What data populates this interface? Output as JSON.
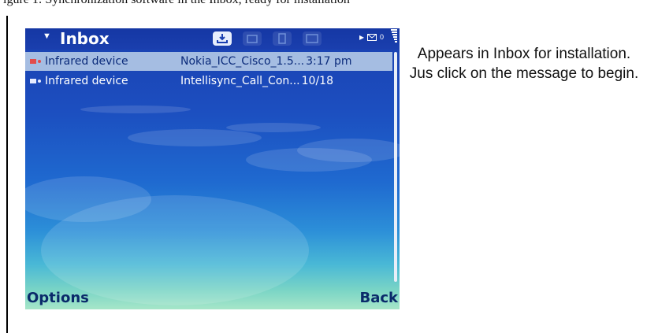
{
  "top_caption": "igure 1: Synchronization software in the Inbox, ready for installation",
  "inbox": {
    "title": "Inbox",
    "messages": [
      {
        "sender": "Infrared device",
        "subject": "Nokia_ICC_Cisco_1.5...",
        "time": "3:17 pm",
        "selected": true
      },
      {
        "sender": "Infrared device",
        "subject": "Intellisync_Call_Con...",
        "time": "10/18",
        "selected": false
      }
    ]
  },
  "softkeys": {
    "left": "Options",
    "right": "Back"
  },
  "caption": "Appears in Inbox for installation. Jus click on the message to begin.",
  "colors": {
    "accent": "#1a3fb0",
    "selection": "#a5bde2"
  }
}
